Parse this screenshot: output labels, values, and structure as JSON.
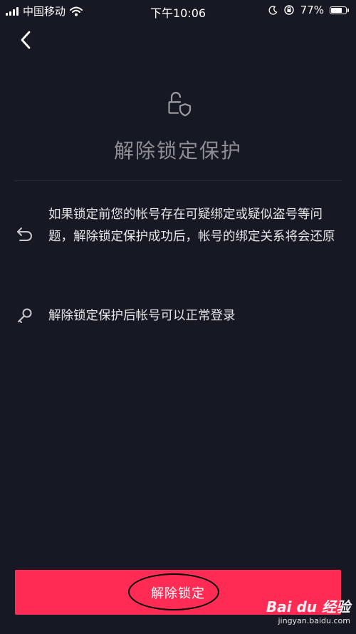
{
  "status_bar": {
    "carrier": "中国移动",
    "time": "下午10:06",
    "battery_percent": "77%",
    "battery_level": 0.77,
    "icons": [
      "signal-icon",
      "wifi-icon",
      "moon-icon",
      "rotation-lock-icon",
      "battery-icon"
    ]
  },
  "header": {
    "back_icon": "chevron-left-icon",
    "lock_icon": "lock-shield-icon",
    "title": "解除锁定保护"
  },
  "info_items": [
    {
      "icon": "undo-arrow-icon",
      "text": "如果锁定前您的帐号存在可疑绑定或疑似盗号等问题，解除锁定保护成功后，帐号的绑定关系将会还原"
    },
    {
      "icon": "key-icon",
      "text": "解除锁定保护后帐号可以正常登录"
    }
  ],
  "action": {
    "unlock_label": "解除锁定"
  },
  "watermark": {
    "brand": "Bai du 经验",
    "url": "jingyan.baidu.com"
  },
  "colors": {
    "background": "#161823",
    "accent": "#fe2c55",
    "title_gray": "#8d8f95",
    "text": "#e6e6e8"
  }
}
